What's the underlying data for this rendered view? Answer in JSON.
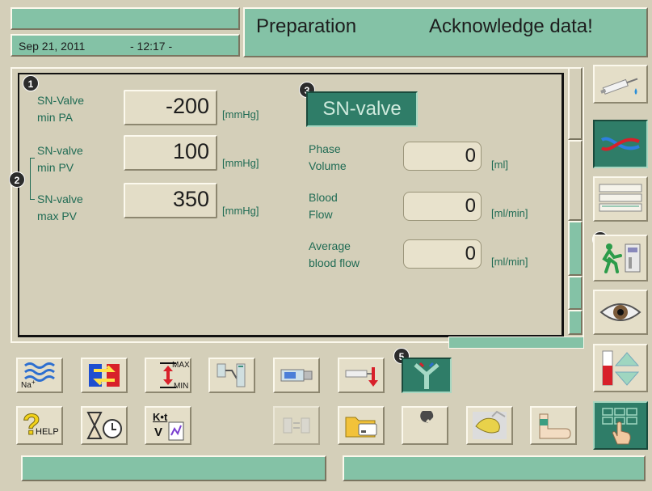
{
  "header": {
    "date": "Sep 21, 2011",
    "time": "- 12:17 -",
    "mode": "Preparation",
    "message": "Acknowledge data!"
  },
  "colors": {
    "teal": "#84c2a6",
    "accent": "#2f7d68",
    "panel": "#d4cfb9"
  },
  "callouts": [
    "1",
    "2",
    "3",
    "4",
    "5"
  ],
  "params": [
    {
      "label_l1": "SN-Valve",
      "label_l2": "min PA",
      "value": "-200",
      "unit": "[mmHg]"
    },
    {
      "label_l1": "SN-valve",
      "label_l2": "min PV",
      "value": "100",
      "unit": "[mmHg]"
    },
    {
      "label_l1": "SN-valve",
      "label_l2": "max PV",
      "value": "350",
      "unit": "[mmHg]"
    }
  ],
  "sn_valve_button": "SN-valve",
  "readouts": [
    {
      "label_l1": "Phase",
      "label_l2": "Volume",
      "value": "0",
      "unit": "[ml]"
    },
    {
      "label_l1": "Blood",
      "label_l2": "Flow",
      "value": "0",
      "unit": "[ml/min]"
    },
    {
      "label_l1": "Average",
      "label_l2": "blood flow",
      "value": "0",
      "unit": "[ml/min]"
    }
  ],
  "toolbar_icons": {
    "na": "Na",
    "na_sup": "+",
    "max": "MAX",
    "min": "MIN",
    "help": "HELP",
    "kt": "K•t",
    "v": "V"
  },
  "side_icons": [
    "syringe-icon",
    "bloodline-icon",
    "list-icon",
    "patient-machine-icon",
    "eye-icon",
    "level-icon",
    "keypad-icon"
  ]
}
